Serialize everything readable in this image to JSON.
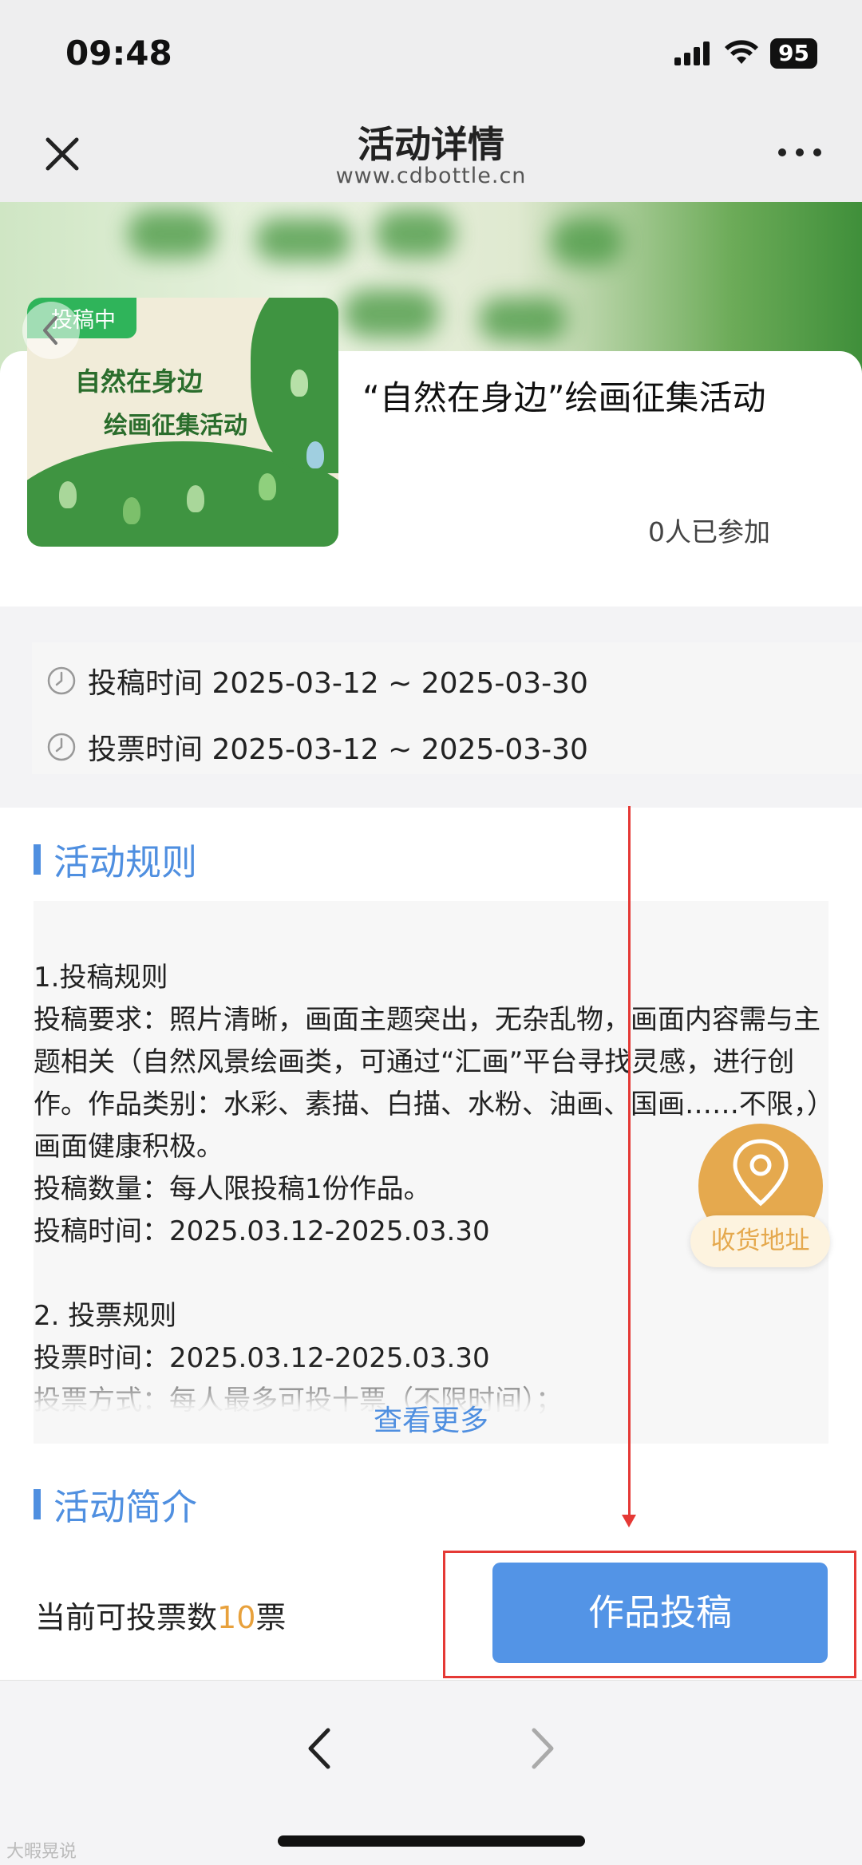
{
  "status_bar": {
    "time": "09:48",
    "battery": "95"
  },
  "nav": {
    "title": "活动详情",
    "domain": "www.cdbottle.cn"
  },
  "activity": {
    "status_tag": "投稿中",
    "cover_line1": "自然在身边",
    "cover_line2": "绘画征集活动",
    "title": "“自然在身边”绘画征集活动",
    "participants": "0人已参加"
  },
  "times": {
    "submission": "投稿时间 2025-03-12 ~ 2025-03-30",
    "voting": "投票时间 2025-03-12 ~ 2025-03-30"
  },
  "rules": {
    "section_title": "活动规则",
    "text": "1.投稿规则\n投稿要求：照片清晰，画面主题突出，无杂乱物，画面内容需与主题相关（自然风景绘画类，可通过“汇画”平台寻找灵感，进行创作。作品类别：水彩、素描、白描、水粉、油画、国画……不限，）画面健康积极。\n投稿数量：每人限投稿1份作品。\n投稿时间：2025.03.12-2025.03.30\n\n2. 投票规则\n投票时间：2025.03.12-2025.03.30\n投票方式：每人最多可投十票（不限时间）；",
    "more_link": "查看更多"
  },
  "intro": {
    "section_title": "活动简介"
  },
  "action": {
    "vote_prefix": "当前可投票数",
    "vote_count": "10",
    "vote_suffix": "票",
    "submit_label": "作品投稿"
  },
  "floating": {
    "address_label": "收货地址"
  },
  "watermark": "大暇晃说",
  "colors": {
    "accent_blue": "#5394e6",
    "accent_orange": "#e5a94e",
    "tag_green": "#2fb45a",
    "annotation_red": "#e53935"
  }
}
